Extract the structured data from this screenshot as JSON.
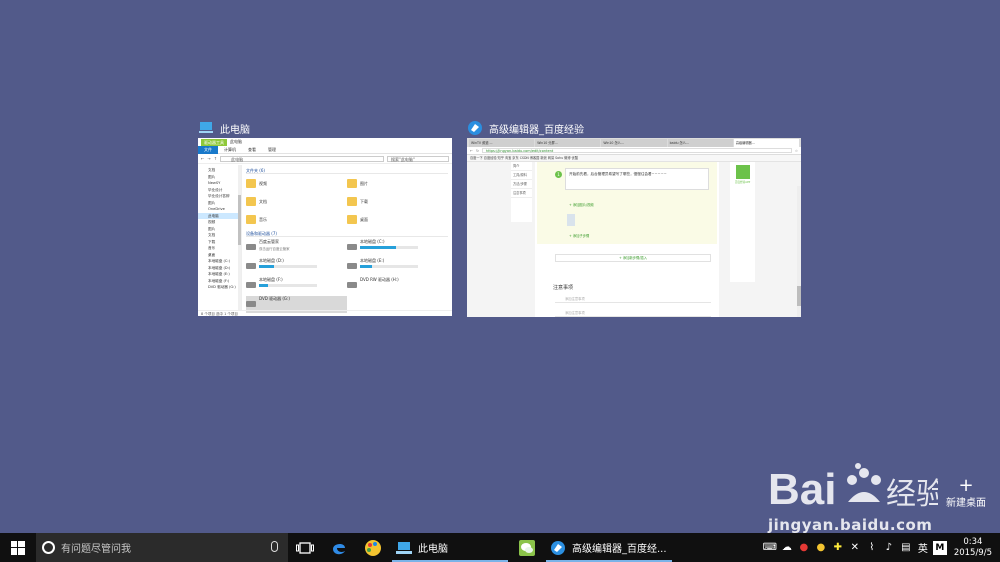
{
  "windows": {
    "explorer": {
      "title": "此电脑",
      "ribbon_context": "驱动器工具",
      "ribbon_context_sub": "此电脑",
      "tabs": [
        "文件",
        "计算机",
        "查看",
        "管理"
      ],
      "address": "此电脑",
      "search_placeholder": "搜索\"此电脑\"",
      "nav_items": [
        "文档",
        "图片",
        "NewSY",
        "毕业设计",
        "毕业设计答辩",
        "图片",
        "OneDrive",
        "此电脑",
        "视频",
        "图片",
        "文档",
        "下载",
        "音乐",
        "桌面",
        "本地磁盘 (C:)",
        "本地磁盘 (D:)",
        "本地磁盘 (E:)",
        "本地磁盘 (F:)",
        "DVD 驱动器 (G:)"
      ],
      "nav_selected": 7,
      "folders_header": "文件夹 (6)",
      "folders": [
        "视频",
        "图片",
        "文档",
        "下载",
        "音乐",
        "桌面"
      ],
      "devices_header": "设备和驱动器 (7)",
      "drives": [
        {
          "name": "百度云管家",
          "sub": "双击运行百度云管家",
          "fill": 0
        },
        {
          "name": "本地磁盘 (C:)",
          "sub": "",
          "fill": 0.62
        },
        {
          "name": "本地磁盘 (D:)",
          "sub": "",
          "fill": 0.25
        },
        {
          "name": "本地磁盘 (E:)",
          "sub": "",
          "fill": 0.2
        },
        {
          "name": "本地磁盘 (F:)",
          "sub": "",
          "fill": 0.15
        },
        {
          "name": "DVD RW 驱动器 (H:)",
          "sub": "",
          "fill": 0
        },
        {
          "name": "DVD 驱动器 (G:)",
          "sub": "",
          "fill": 0
        }
      ],
      "status": "8 个项目   选中 1 个项目"
    },
    "editor": {
      "title": "高级编辑器_百度经验",
      "tabs": [
        "WinTV 频道 ...",
        "Win10 分屏...",
        "Win10 怎么...",
        "baidu 怎么...",
        "高级编辑器..."
      ],
      "url": "https://jingyan.baidu.com/edit/content",
      "bookmarks": "百度一下  百度经验  知乎  淘宝  京东  CSDN  博客园  新浪  网易  Sohu  微博  优酷",
      "side_items": [
        "简介",
        "工具/原料",
        "方法/步骤",
        "注意事项"
      ],
      "step_num": "1",
      "step_text": "开始前先看，后台管理员希望写了哪些，慢慢往会看~~~~~",
      "add_image": "+ 添加图片/视频",
      "add_sub": "+ 添加子步骤",
      "add_step": "+ 添加新步骤/插入",
      "notes_title": "注意事项",
      "note_placeholder": "添加注意事项",
      "side_caption": "百度经验APP"
    }
  },
  "new_desktop": {
    "plus": "+",
    "label": "新建桌面"
  },
  "watermark": {
    "url": "jingyan.baidu.com",
    "logo_text": "Bai du 经验"
  },
  "taskbar": {
    "search_placeholder": "有问题尽管问我",
    "running_apps": [
      {
        "label": "此电脑",
        "icon": "computer-icon"
      },
      {
        "label": "高级编辑器_百度经...",
        "icon": "browser-icon"
      }
    ],
    "ime": "英",
    "clock_time": "0:34",
    "clock_date": "2015/9/5"
  },
  "colors": {
    "desktop": "#525a8a",
    "taskbar": "#101010",
    "accent": "#1979ca",
    "green": "#6cc24a"
  }
}
